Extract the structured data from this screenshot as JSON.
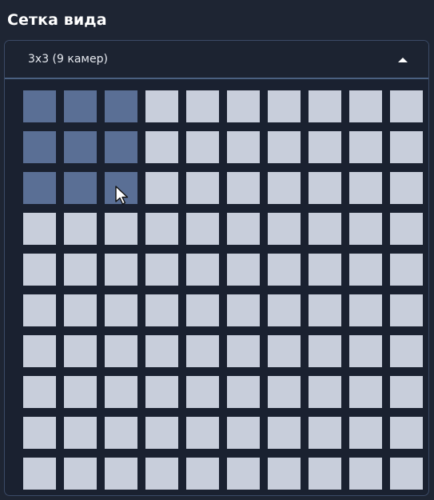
{
  "title": "Сетка вида",
  "layout_select": {
    "value": "3x3 (9 камер)",
    "expanded": true,
    "caret_icon": "caret-up-icon"
  },
  "grid": {
    "rows": 10,
    "cols": 10,
    "selected_rows": 3,
    "selected_cols": 3
  },
  "colors": {
    "background": "#1e2533",
    "cell": "#c8cedb",
    "cell_selected": "#5a6f95",
    "panel_border": "#3b4a66",
    "text": "#ffffff"
  }
}
